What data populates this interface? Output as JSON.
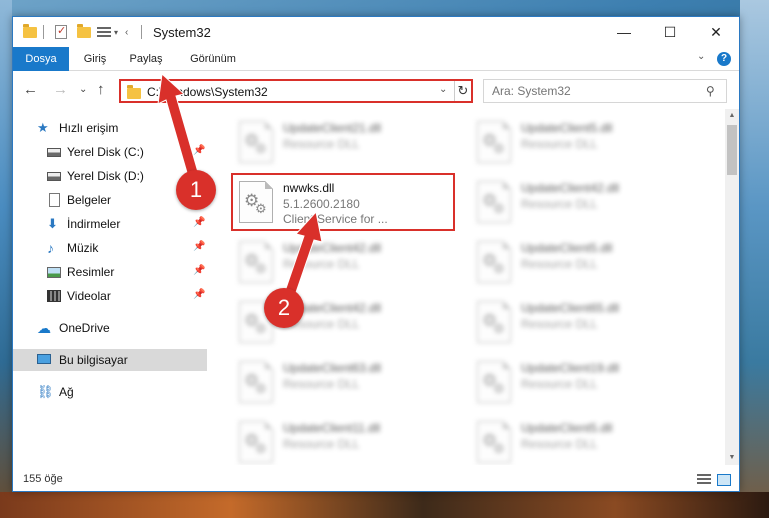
{
  "window": {
    "title": "System32"
  },
  "window_controls": {
    "minimize": "—",
    "maximize": "☐",
    "close": "✕"
  },
  "ribbon": {
    "tabs": [
      {
        "label": "Dosya",
        "active": true
      },
      {
        "label": "Giriş"
      },
      {
        "label": "Paylaş"
      },
      {
        "label": "Görünüm"
      }
    ],
    "expand_glyph": "⌄",
    "help_glyph": "?"
  },
  "nav": {
    "back_glyph": "←",
    "forward_glyph": "→",
    "recent_glyph": "⌄",
    "up_glyph": "↑",
    "address": "C:\\Windows\\System32",
    "address_drop_glyph": "⌄",
    "refresh_glyph": "↻",
    "search_placeholder": "Ara: System32",
    "search_glyph": "⚲"
  },
  "sidebar": {
    "items": [
      {
        "label": "Hızlı erişim",
        "icon": "star-icon",
        "glyph": "★"
      },
      {
        "label": "Yerel Disk (C:)",
        "icon": "disk-icon",
        "pinned": true
      },
      {
        "label": "Yerel Disk (D:)",
        "icon": "disk-icon"
      },
      {
        "label": "Belgeler",
        "icon": "document-icon",
        "pinned": true
      },
      {
        "label": "İndirmeler",
        "icon": "download-icon",
        "glyph": "⬇",
        "pinned": true
      },
      {
        "label": "Müzik",
        "icon": "music-icon",
        "glyph": "♪",
        "pinned": true
      },
      {
        "label": "Resimler",
        "icon": "pictures-icon",
        "pinned": true
      },
      {
        "label": "Videolar",
        "icon": "video-icon",
        "pinned": true
      },
      {
        "label": "OneDrive",
        "icon": "cloud-icon",
        "glyph": "☁"
      },
      {
        "label": "Bu bilgisayar",
        "icon": "computer-icon",
        "selected": true
      },
      {
        "label": "Ağ",
        "icon": "network-icon",
        "glyph": "⛓"
      }
    ],
    "pin_glyph": "📌"
  },
  "files": {
    "focused": {
      "name": "nwwks.dll",
      "version": "5.1.2600.2180",
      "description": "Client Service for ..."
    },
    "background": [
      {
        "name": "UpdateClient21.dll",
        "description": "Resource DLL"
      },
      {
        "name": "UpdateClient5.dll",
        "description": "Resource DLL"
      },
      {
        "name": "UpdateClient42.dll",
        "description": "Resource DLL"
      },
      {
        "name": "UpdateClient42.dll",
        "description": "Resource DLL"
      },
      {
        "name": "UpdateClient5.dll",
        "description": "Resource DLL"
      },
      {
        "name": "UpdateClient42.dll",
        "description": "Resource DLL"
      },
      {
        "name": "UpdateClient65.dll",
        "description": "Resource DLL"
      },
      {
        "name": "UpdateClient63.dll",
        "description": "Resource DLL"
      },
      {
        "name": "UpdateClient19.dll",
        "description": "Resource DLL"
      },
      {
        "name": "UpdateClient11.dll",
        "description": "Resource DLL"
      },
      {
        "name": "UpdateClient5.dll",
        "description": "Resource DLL"
      }
    ]
  },
  "status": {
    "item_count": "155 öğe"
  },
  "annotations": {
    "step1": "1",
    "step2": "2",
    "color": "#d9302a"
  },
  "scrollbar": {
    "up_glyph": "▲",
    "down_glyph": "▼"
  },
  "gear_glyph": "⚙"
}
